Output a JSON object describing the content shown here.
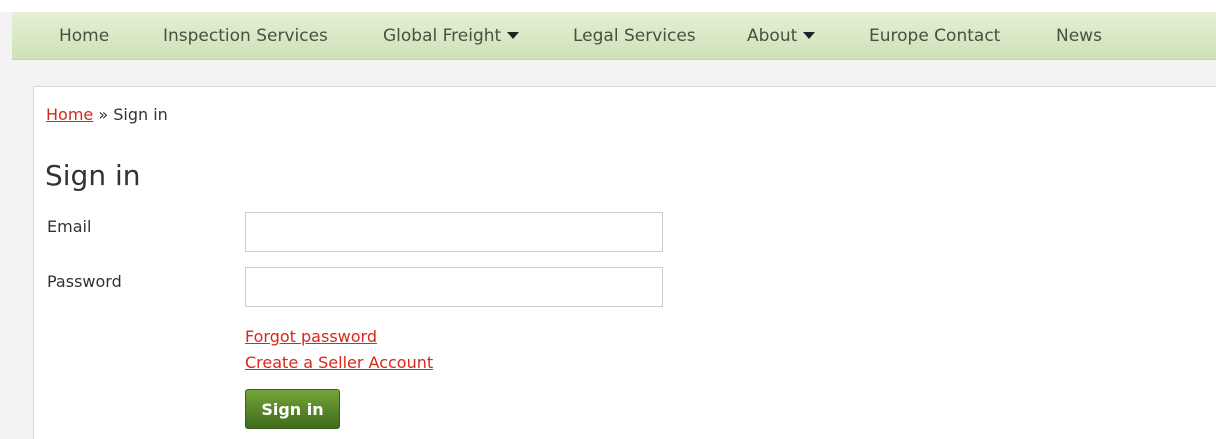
{
  "nav": {
    "items": [
      {
        "label": "Home",
        "has_dropdown": false
      },
      {
        "label": "Inspection Services",
        "has_dropdown": false
      },
      {
        "label": "Global Freight",
        "has_dropdown": true
      },
      {
        "label": "Legal Services",
        "has_dropdown": false
      },
      {
        "label": "About",
        "has_dropdown": true
      },
      {
        "label": "Europe Contact",
        "has_dropdown": false
      },
      {
        "label": "News",
        "has_dropdown": false
      }
    ]
  },
  "breadcrumb": {
    "home": "Home",
    "separator": " » ",
    "current": "Sign in"
  },
  "page": {
    "title": "Sign in"
  },
  "form": {
    "email_label": "Email",
    "email_value": "",
    "password_label": "Password",
    "password_value": "",
    "forgot_password": "Forgot password",
    "create_account": "Create a Seller Account",
    "submit_label": "Sign in"
  },
  "colors": {
    "link": "#d9271b",
    "nav_bg": "#d9e8c4",
    "button": "#4e7e25"
  }
}
